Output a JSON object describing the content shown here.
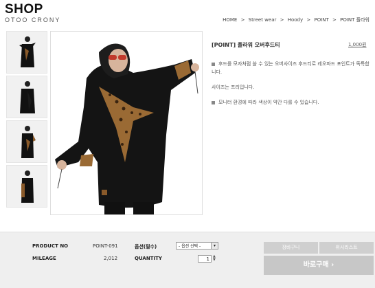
{
  "header": {
    "title": "SHOP",
    "subtitle": "OTOO CRONY",
    "breadcrumb": [
      "HOME",
      ">",
      "Street wear",
      ">",
      "Hoody",
      ">",
      "POINT",
      ">",
      "POINT 플라워"
    ]
  },
  "product": {
    "name": "[POINT] 플라워 오버후드티",
    "price": "1,000원",
    "description": [
      "후드를 모자처럼 쓸 수 있는 오버사이즈 후드티로 레오파드 포인트가 독특합니다.",
      "사이즈는 프리입니다.",
      "모니터 환경에 따라 색상이 약간 다를 수 있습니다."
    ]
  },
  "order": {
    "product_no_label": "PRODUCT NO",
    "product_no_value": "POINT-091",
    "mileage_label": "MILEAGE",
    "mileage_value": "2,012",
    "option_label": "옵션(필수)",
    "option_selected": "- 옵션 선택 -",
    "quantity_label": "QUANTITY",
    "quantity_value": "1",
    "cart_label": "장바구니",
    "wishlist_label": "위시리스트",
    "buy_label": "바로구매 ›"
  },
  "colors": {
    "accent_bar": "#efefef",
    "button_gray": "#cfcfcf"
  }
}
